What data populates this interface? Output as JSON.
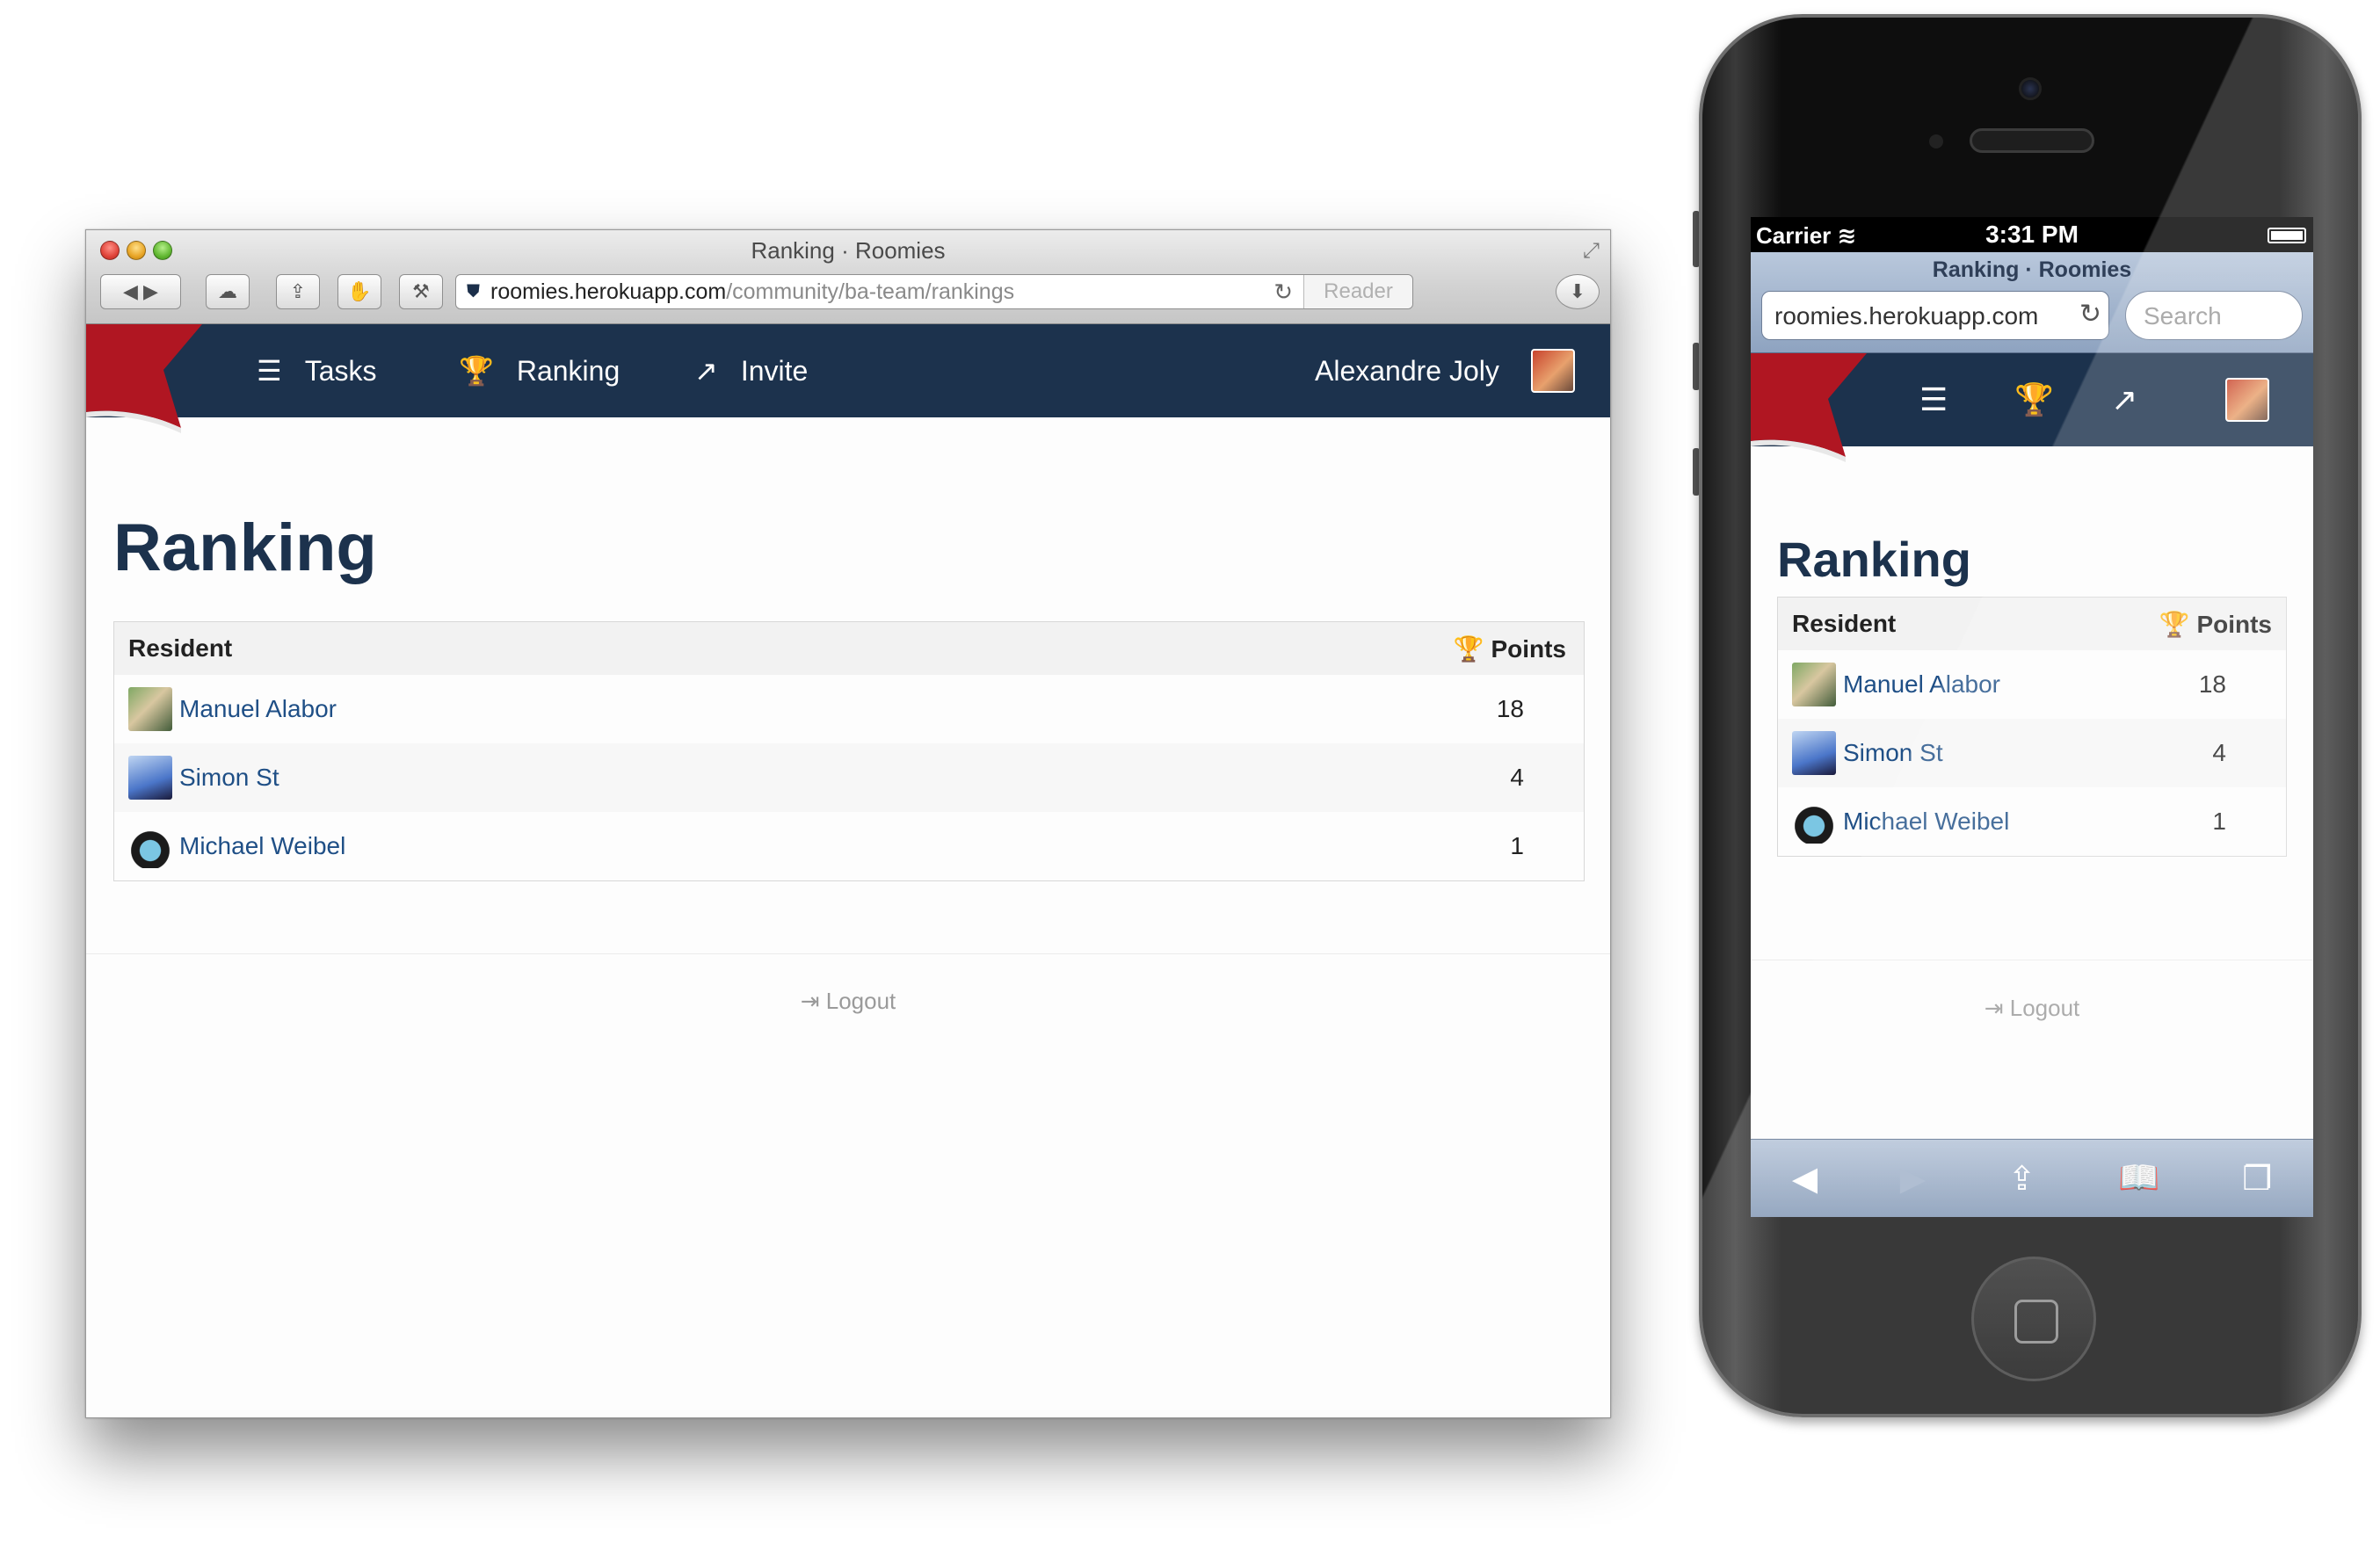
{
  "desktop": {
    "window_title": "Ranking · Roomies",
    "url_host": "roomies.herokuapp.com",
    "url_path": "/community/ba-team/rankings",
    "reader_label": "Reader",
    "nav": {
      "tasks": "Tasks",
      "ranking": "Ranking",
      "invite": "Invite",
      "user": "Alexandre Joly"
    },
    "page_title": "Ranking",
    "table": {
      "col_resident": "Resident",
      "col_points": "Points",
      "rows": [
        {
          "name": "Manuel Alabor",
          "points": "18"
        },
        {
          "name": "Simon St",
          "points": "4"
        },
        {
          "name": "Michael Weibel",
          "points": "1"
        }
      ]
    },
    "logout": "Logout"
  },
  "mobile": {
    "carrier": "Carrier",
    "time": "3:31 PM",
    "title": "Ranking · Roomies",
    "url": "roomies.herokuapp.com",
    "search_placeholder": "Search",
    "page_title": "Ranking",
    "table": {
      "col_resident": "Resident",
      "col_points": "Points",
      "rows": [
        {
          "name": "Manuel Alabor",
          "points": "18"
        },
        {
          "name": "Simon St",
          "points": "4"
        },
        {
          "name": "Michael Weibel",
          "points": "1"
        }
      ]
    },
    "logout": "Logout"
  },
  "colors": {
    "navbar": "#1c324d",
    "flag": "#b01622",
    "link": "#1f4f86"
  },
  "icons": [
    "tasks-icon",
    "trophy-icon",
    "share-icon",
    "logout-icon",
    "reload-icon",
    "lock-icon"
  ]
}
